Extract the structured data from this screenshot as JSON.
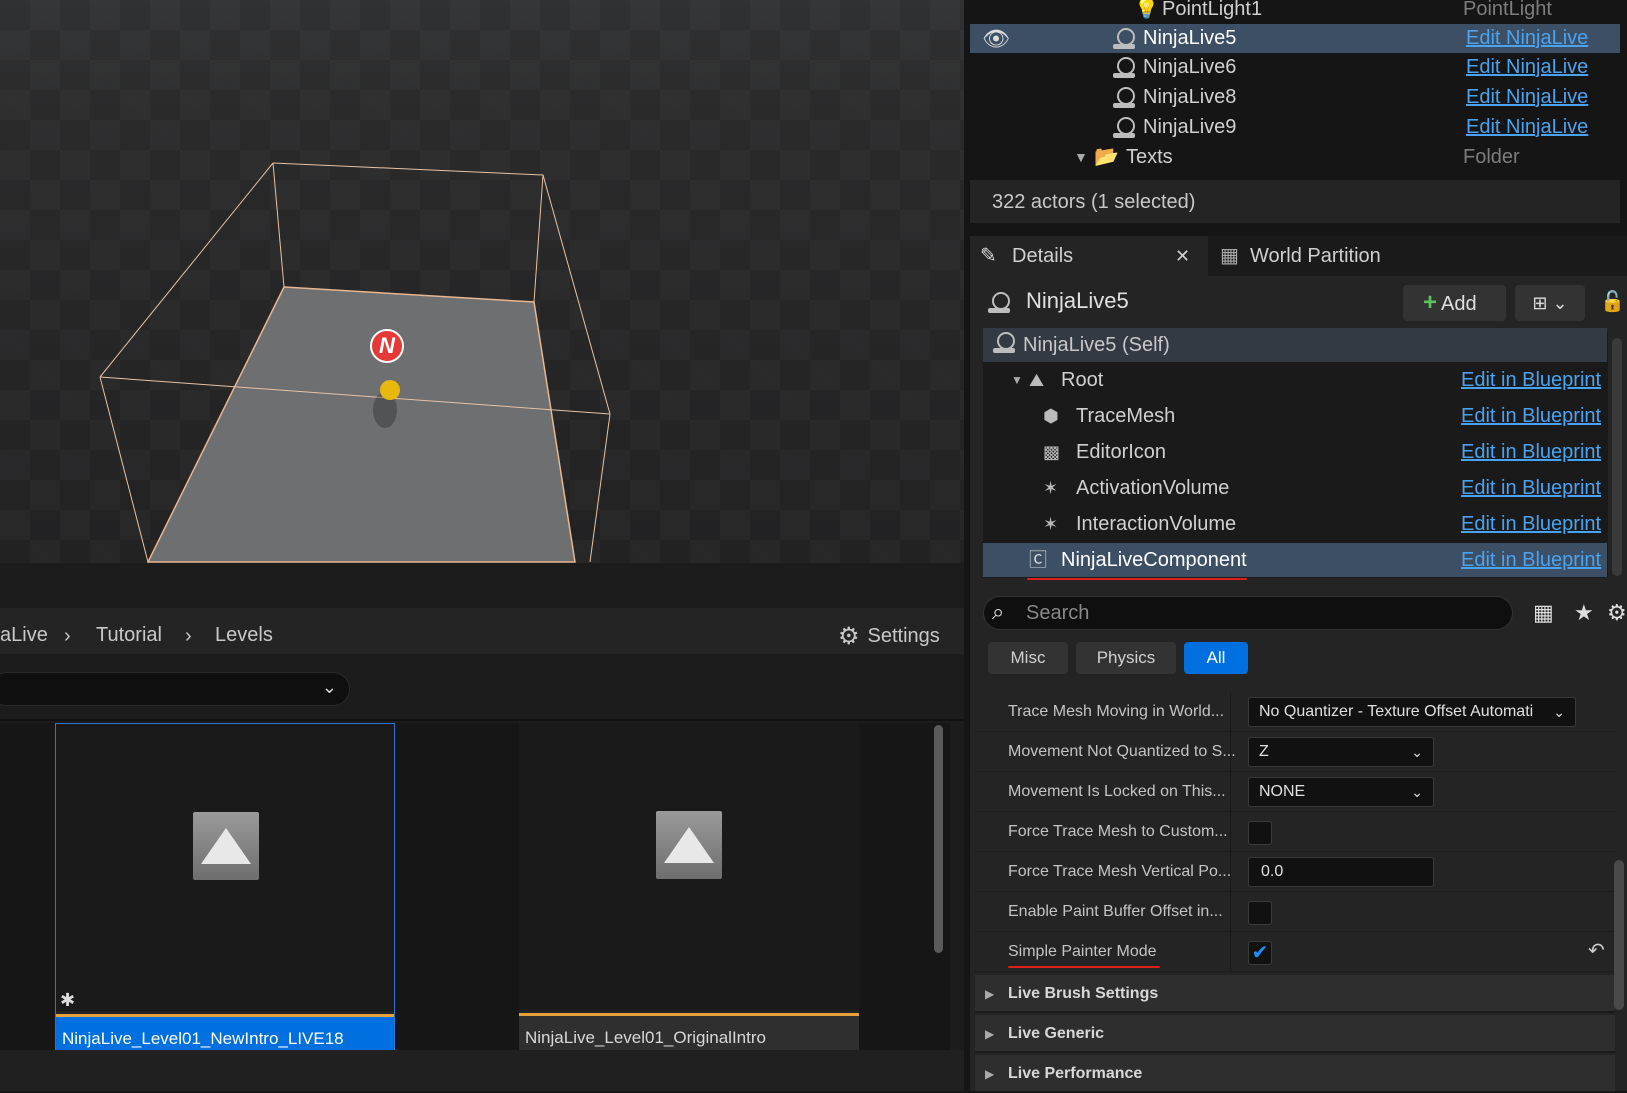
{
  "outliner": {
    "rows": [
      {
        "label": "PointLight1",
        "type": "PointLight"
      },
      {
        "label": "NinjaLive5",
        "link": "Edit NinjaLive"
      },
      {
        "label": "NinjaLive6",
        "link": "Edit NinjaLive"
      },
      {
        "label": "NinjaLive8",
        "link": "Edit NinjaLive"
      },
      {
        "label": "NinjaLive9",
        "link": "Edit NinjaLive"
      },
      {
        "label": "Texts",
        "type": "Folder"
      }
    ],
    "status": "322 actors (1 selected)"
  },
  "tabs": {
    "details": "Details",
    "world_partition": "World Partition"
  },
  "details": {
    "actor_name": "NinjaLive5",
    "add_label": "Add",
    "components": [
      {
        "label": "NinjaLive5 (Self)",
        "icon": "pawn-icon"
      },
      {
        "label": "Root",
        "icon": "scene-root-icon",
        "link": "Edit in Blueprint"
      },
      {
        "label": "TraceMesh",
        "icon": "mesh-cube-icon",
        "link": "Edit in Blueprint"
      },
      {
        "label": "EditorIcon",
        "icon": "billboard-icon",
        "link": "Edit in Blueprint"
      },
      {
        "label": "ActivationVolume",
        "icon": "volume-icon",
        "link": "Edit in Blueprint"
      },
      {
        "label": "InteractionVolume",
        "icon": "volume-icon",
        "link": "Edit in Blueprint"
      },
      {
        "label": "NinjaLiveComponent",
        "icon": "component-icon",
        "link": "Edit in Blueprint"
      }
    ],
    "search_placeholder": "Search",
    "filters": [
      "Misc",
      "Physics",
      "All"
    ],
    "properties": [
      {
        "name": "Trace Mesh Moving in World...",
        "value": "No Quantizer - Texture Offset Automati"
      },
      {
        "name": "Movement Not Quantized to S...",
        "value": "Z"
      },
      {
        "name": "Movement Is Locked on This...",
        "value": "NONE"
      },
      {
        "name": "Force Trace Mesh to Custom...",
        "checked": false
      },
      {
        "name": "Force Trace Mesh Vertical Po...",
        "value": "0.0"
      },
      {
        "name": "Enable Paint Buffer Offset in...",
        "checked": false
      },
      {
        "name": "Simple Painter Mode",
        "checked": true
      }
    ],
    "sections": [
      "Live Brush Settings",
      "Live Generic",
      "Live Performance"
    ]
  },
  "content_browser": {
    "breadcrumb": [
      "aLive",
      "Tutorial",
      "Levels"
    ],
    "settings_label": "Settings",
    "assets": [
      {
        "name": "NinjaLive_Level01_NewIntro_LIVE18",
        "selected": true
      },
      {
        "name": "NinjaLive_Level01_OriginalIntro",
        "selected": false
      }
    ]
  },
  "colors": {
    "accent": "#0070e0",
    "link": "#4aa3f0",
    "selection_row": "#3d4f64",
    "asset_underline": "#e8a13a",
    "annotation_red": "#e0201a"
  }
}
